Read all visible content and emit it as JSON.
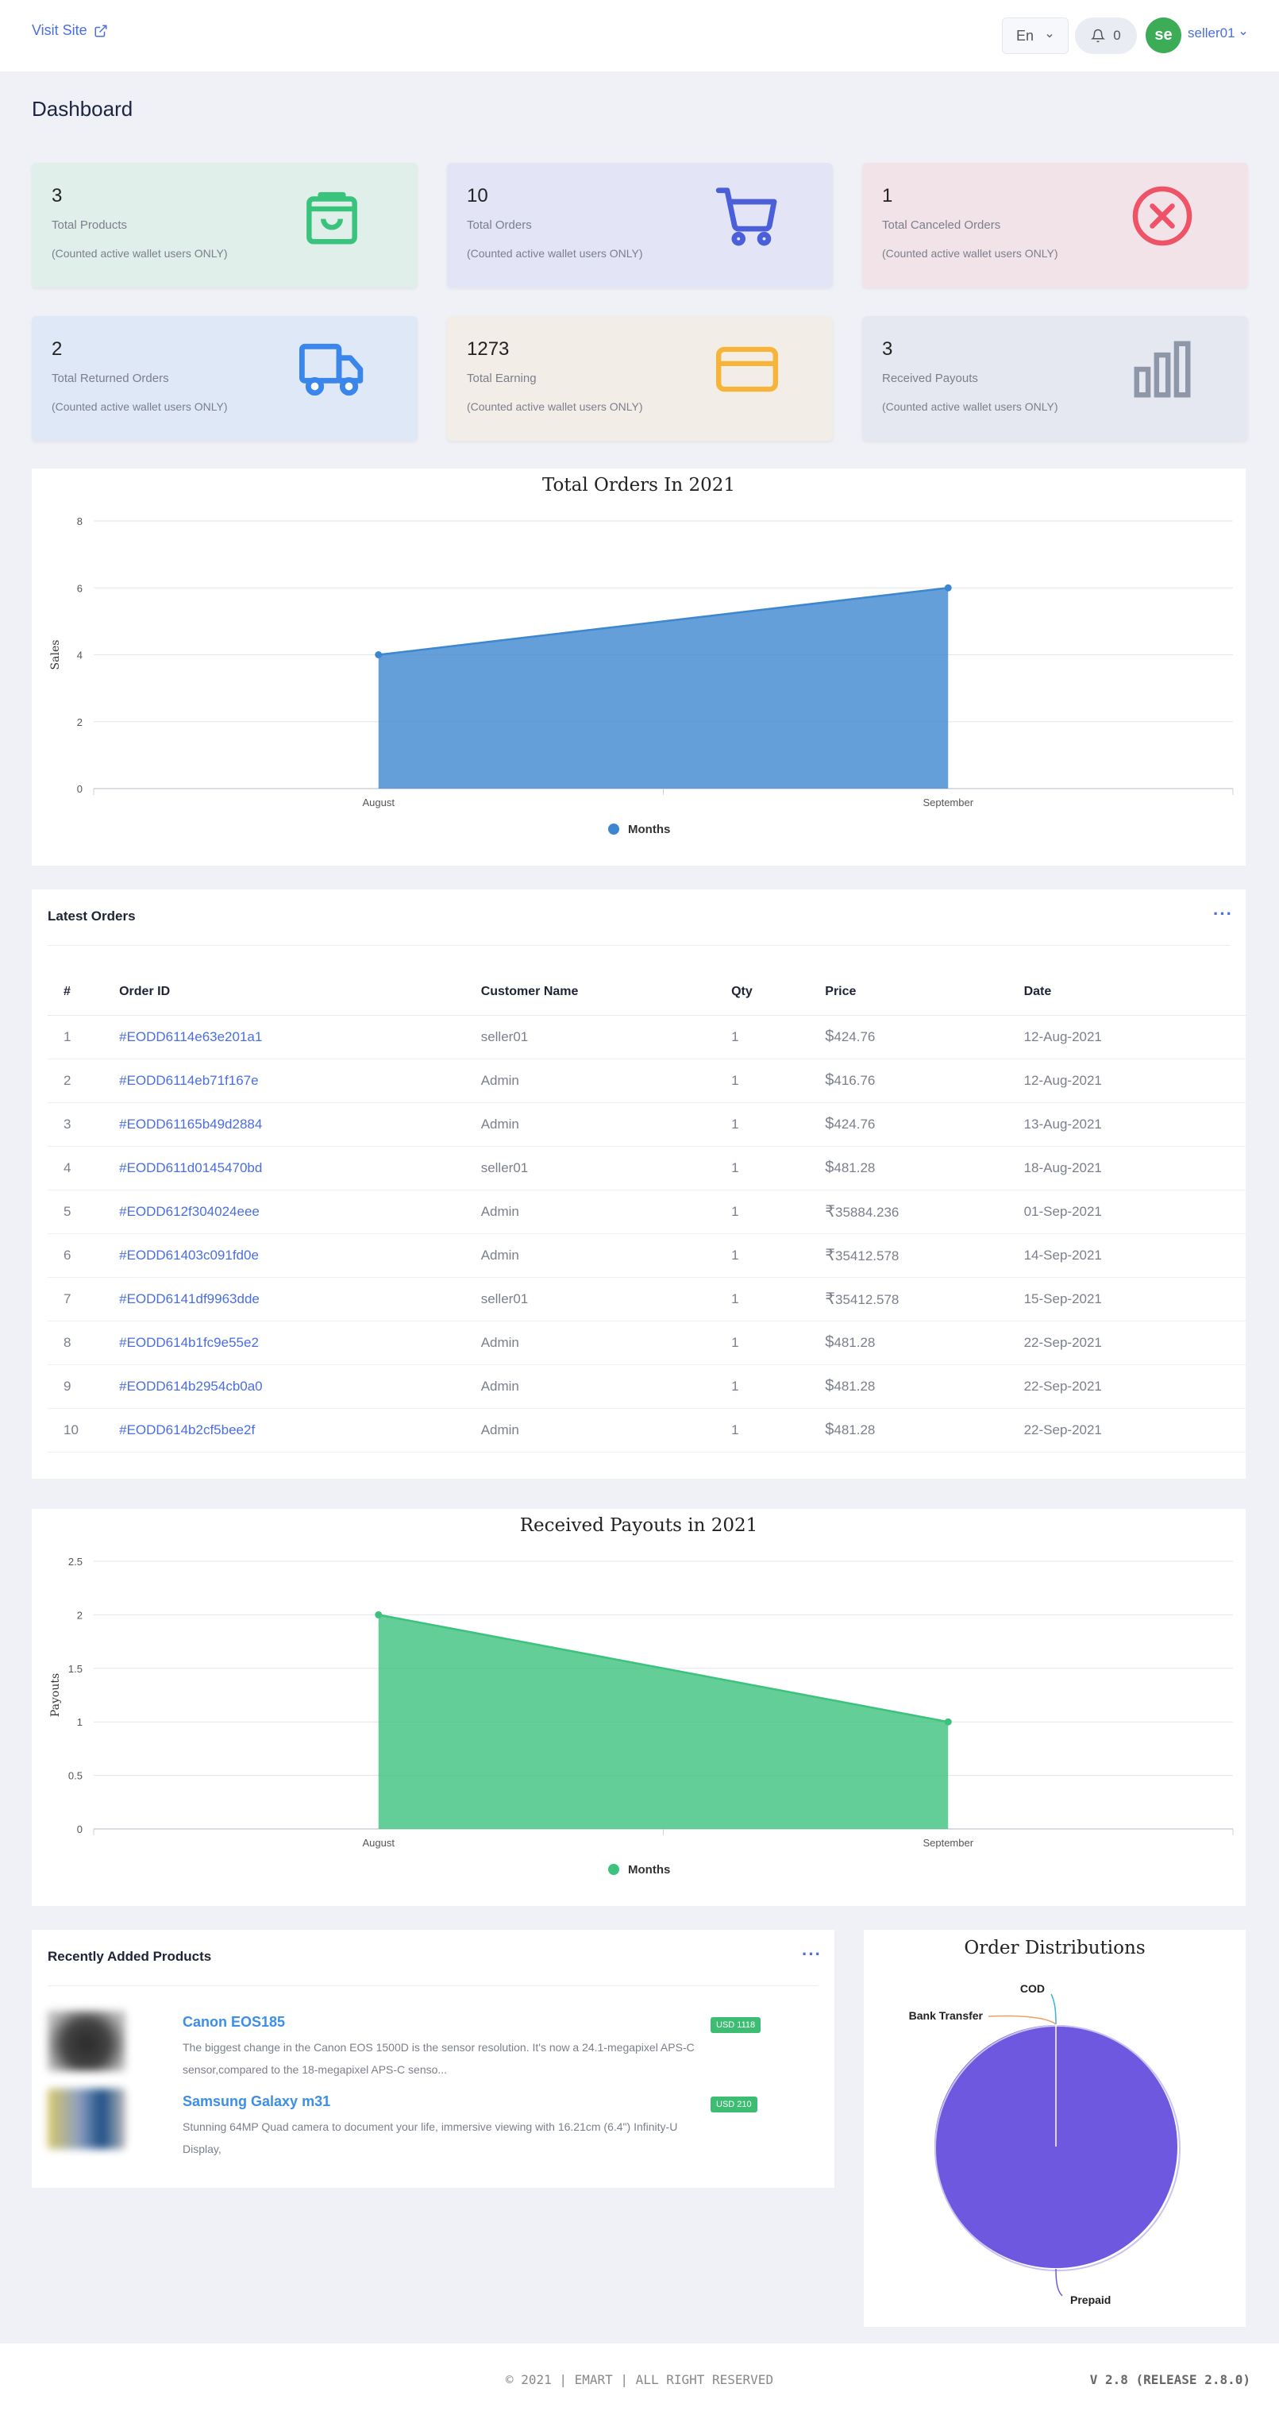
{
  "header": {
    "visit_site": "Visit Site",
    "lang": "En",
    "notif_count": "0",
    "avatar_initials": "se",
    "username": "seller01"
  },
  "page_title": "Dashboard",
  "stats": [
    {
      "value": "3",
      "label": "Total Products",
      "note": "(Counted active wallet users ONLY)",
      "icon": "shopping-bag-icon",
      "bg": "#e1efea",
      "color": "#39c37c"
    },
    {
      "value": "10",
      "label": "Total Orders",
      "note": "(Counted active wallet users ONLY)",
      "icon": "shopping-cart-icon",
      "bg": "#e3e5f7",
      "color": "#4a5fd8"
    },
    {
      "value": "1",
      "label": "Total Canceled Orders",
      "note": "(Counted active wallet users ONLY)",
      "icon": "cancel-circle-icon",
      "bg": "#f2e3e8",
      "color": "#ee5368"
    },
    {
      "value": "2",
      "label": "Total Returned Orders",
      "note": "(Counted active wallet users ONLY)",
      "icon": "truck-icon",
      "bg": "#dfe8f6",
      "color": "#3b86ea"
    },
    {
      "value": "1273",
      "label": "Total Earning",
      "note": "(Counted active wallet users ONLY)",
      "icon": "credit-card-icon",
      "bg": "#f3ede8",
      "color": "#f7b43a"
    },
    {
      "value": "3",
      "label": "Received Payouts",
      "note": "(Counted active wallet users ONLY)",
      "icon": "bar-chart-icon",
      "bg": "#e5e8f0",
      "color": "#8d97a8"
    }
  ],
  "chart_data": [
    {
      "type": "area",
      "title": "Total Orders In 2021",
      "ylabel": "Sales",
      "xlabel": "",
      "categories": [
        "August",
        "September"
      ],
      "series": [
        {
          "name": "Months",
          "values": [
            4,
            6
          ]
        }
      ],
      "ylim": [
        0,
        8
      ],
      "yticks": [
        "0",
        "2",
        "4",
        "6",
        "8"
      ],
      "color": "#3d87d0",
      "grid": true,
      "legend": "bottom"
    },
    {
      "type": "area",
      "title": "Received Payouts in 2021",
      "ylabel": "Payouts",
      "xlabel": "",
      "categories": [
        "August",
        "September"
      ],
      "series": [
        {
          "name": "Months",
          "values": [
            2,
            1
          ]
        }
      ],
      "ylim": [
        0,
        2.5
      ],
      "yticks": [
        "0",
        "0.5",
        "1",
        "1.5",
        "2",
        "2.5"
      ],
      "color": "#3cc27d",
      "grid": true,
      "legend": "bottom"
    },
    {
      "type": "pie",
      "title": "Order Distributions",
      "categories": [
        "COD",
        "Bank Transfer",
        "Prepaid"
      ],
      "values": [
        0,
        0,
        100
      ],
      "colors": [
        "#37b3e0",
        "#f0a060",
        "#6e58e0"
      ],
      "legend": "none"
    }
  ],
  "latest_orders": {
    "title": "Latest Orders",
    "menu": "···",
    "columns": [
      "#",
      "Order ID",
      "Customer Name",
      "Qty",
      "Price",
      "Date"
    ],
    "rows": [
      [
        "1",
        "#EODD6114e63e201a1",
        "seller01",
        "1",
        "$",
        "424.76",
        "12-Aug-2021"
      ],
      [
        "2",
        "#EODD6114eb71f167e",
        "Admin",
        "1",
        "$",
        "416.76",
        "12-Aug-2021"
      ],
      [
        "3",
        "#EODD61165b49d2884",
        "Admin",
        "1",
        "$",
        "424.76",
        "13-Aug-2021"
      ],
      [
        "4",
        "#EODD611d0145470bd",
        "seller01",
        "1",
        "$",
        "481.28",
        "18-Aug-2021"
      ],
      [
        "5",
        "#EODD612f304024eee",
        "Admin",
        "1",
        "₹",
        "35884.236",
        "01-Sep-2021"
      ],
      [
        "6",
        "#EODD61403c091fd0e",
        "Admin",
        "1",
        "₹",
        "35412.578",
        "14-Sep-2021"
      ],
      [
        "7",
        "#EODD6141df9963dde",
        "seller01",
        "1",
        "₹",
        "35412.578",
        "15-Sep-2021"
      ],
      [
        "8",
        "#EODD614b1fc9e55e2",
        "Admin",
        "1",
        "$",
        "481.28",
        "22-Sep-2021"
      ],
      [
        "9",
        "#EODD614b2954cb0a0",
        "Admin",
        "1",
        "$",
        "481.28",
        "22-Sep-2021"
      ],
      [
        "10",
        "#EODD614b2cf5bee2f",
        "Admin",
        "1",
        "$",
        "481.28",
        "22-Sep-2021"
      ]
    ]
  },
  "recent_products": {
    "title": "Recently Added Products",
    "menu": "···",
    "items": [
      {
        "name": "Canon EOS185",
        "price": "USD 1118",
        "desc": "The biggest change in the Canon EOS 1500D is the sensor resolution. It's now a 24.1-megapixel APS-C sensor,compared to the 18-megapixel APS-C senso..."
      },
      {
        "name": "Samsung Galaxy m31",
        "price": "USD 210",
        "desc": "Stunning 64MP Quad camera to document your life, immersive viewing with 16.21cm (6.4\") Infinity-U Display,"
      }
    ]
  },
  "footer": {
    "copyright": "© 2021 | EMART | ALL RIGHT RESERVED",
    "version": "V 2.8 (RELEASE 2.8.0)"
  }
}
